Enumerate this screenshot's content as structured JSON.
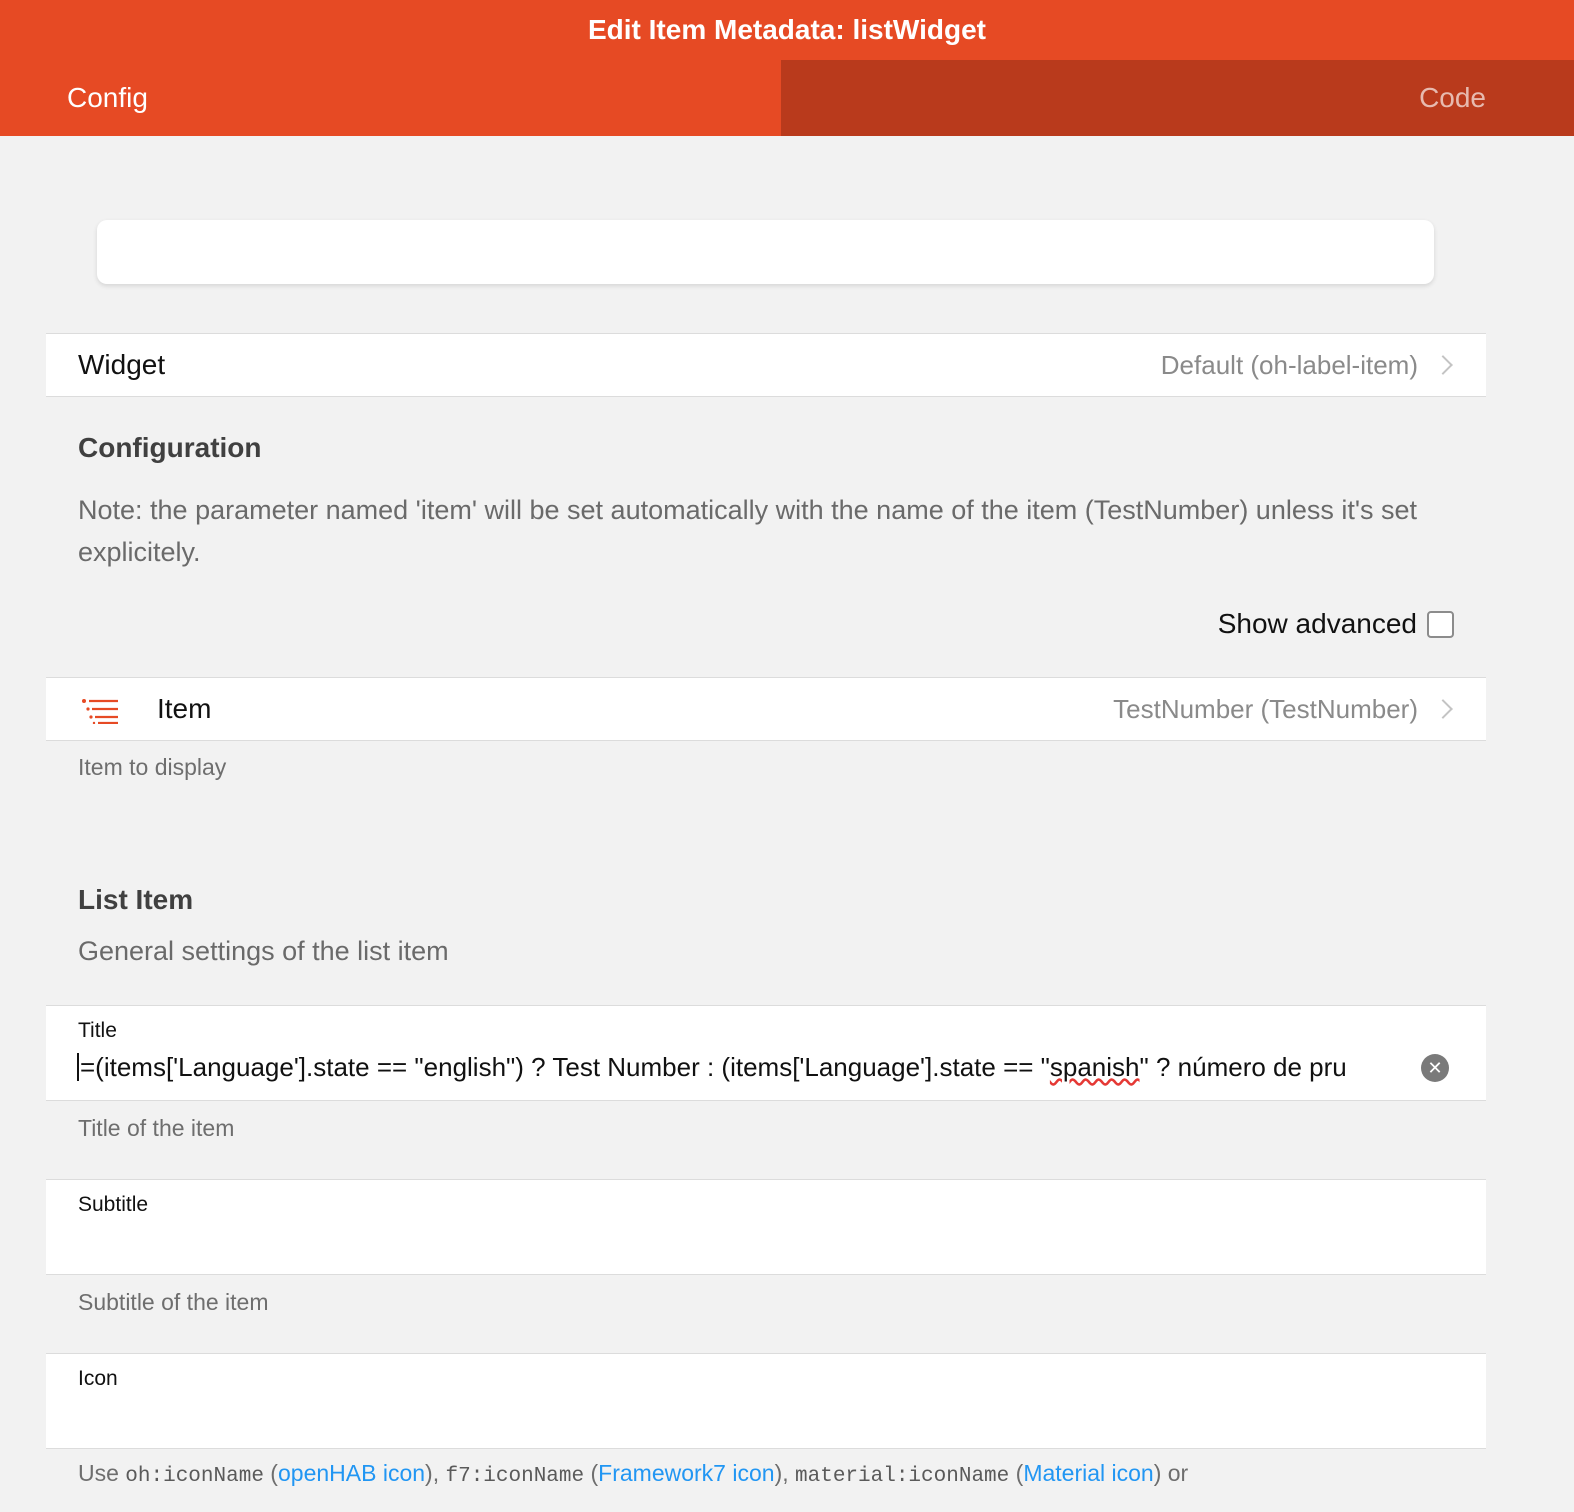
{
  "navbar": {
    "title": "Edit Item Metadata: listWidget"
  },
  "tabs": [
    {
      "label": "Config"
    },
    {
      "label": "Code"
    }
  ],
  "search": {
    "placeholder": ""
  },
  "widget": {
    "label": "Widget",
    "value": "Default (oh-label-item)"
  },
  "configuration": {
    "title": "Configuration",
    "note": "Note: the parameter named 'item' will be set automatically with the name of the item (TestNumber) unless it's set explicitely."
  },
  "advanced": {
    "label": "Show advanced",
    "checked": false
  },
  "item_param": {
    "icon": "list-icon",
    "label": "Item",
    "value": "TestNumber (TestNumber)",
    "description": "Item to display"
  },
  "list_item": {
    "title": "List Item",
    "description": "General settings of the list item"
  },
  "title_field": {
    "label": "Title",
    "value_before": "=(items['Language'].state == \"english\") ? Test Number : (items['Language'].state == \"",
    "value_misspelled": "spanish",
    "value_after": "\" ? número de pru",
    "description": "Title of the item"
  },
  "subtitle_field": {
    "label": "Subtitle",
    "value": "",
    "description": "Subtitle of the item"
  },
  "icon_field": {
    "label": "Icon",
    "value": "",
    "help": {
      "use": "Use ",
      "code_oh": "oh:iconName",
      "paren_open": " (",
      "link_openhab": "openHAB icon",
      "sep1": "), ",
      "code_f7": "f7:iconName",
      "link_f7": "Framework7 icon",
      "code_material": "material:iconName",
      "link_material": "Material icon",
      "suffix": ") or"
    }
  },
  "colors": {
    "accent": "#e64a24",
    "accent_dark": "#b93a1c",
    "link": "#2196f3"
  }
}
